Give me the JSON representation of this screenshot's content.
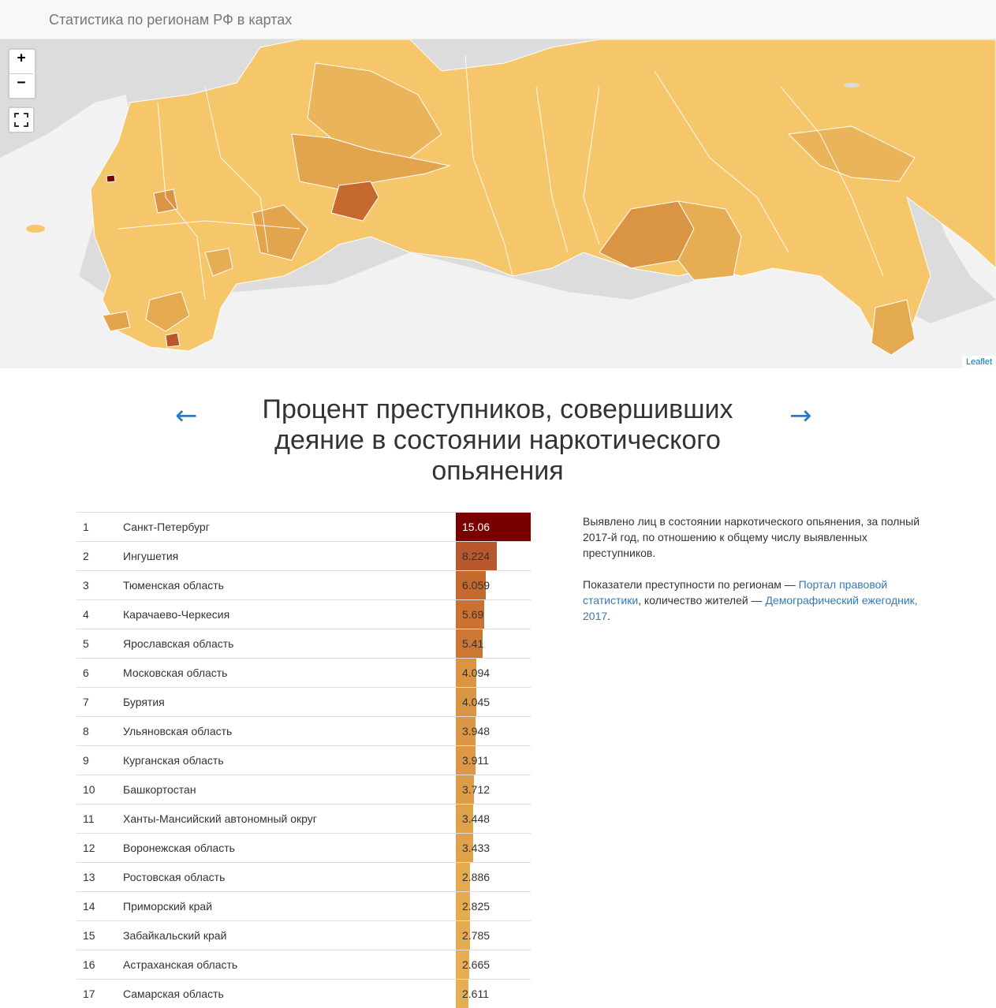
{
  "navbar": {
    "brand": "Статистика по регионам РФ в картах"
  },
  "map": {
    "zoom_in": "+",
    "zoom_out": "−",
    "attribution": "Leaflet"
  },
  "nav": {
    "prev": "←",
    "next": "→"
  },
  "title": "Процент преступников, совершивших деяние в состоянии наркотического опьянения",
  "colors": {
    "max": "#7a0000",
    "high": "#b9582c",
    "mid": "#d9843a",
    "low": "#e3a44e",
    "base": "#f5c76a",
    "link": "#337ab7"
  },
  "table": {
    "max_value": 15.06,
    "rows": [
      {
        "rank": "1",
        "name": "Санкт-Петербург",
        "value": "15.06",
        "num": 15.06,
        "color": "#7a0000",
        "light": true
      },
      {
        "rank": "2",
        "name": "Ингушетия",
        "value": "8.224",
        "num": 8.224,
        "color": "#b9582c",
        "light": false
      },
      {
        "rank": "3",
        "name": "Тюменская область",
        "value": "6.059",
        "num": 6.059,
        "color": "#c6692e",
        "light": false
      },
      {
        "rank": "4",
        "name": "Карачаево-Черкесия",
        "value": "5.69",
        "num": 5.69,
        "color": "#cb7233",
        "light": false
      },
      {
        "rank": "5",
        "name": "Ярославская область",
        "value": "5.41",
        "num": 5.41,
        "color": "#cd7735",
        "light": false
      },
      {
        "rank": "6",
        "name": "Московская область",
        "value": "4.094",
        "num": 4.094,
        "color": "#da9443",
        "light": false
      },
      {
        "rank": "7",
        "name": "Бурятия",
        "value": "4.045",
        "num": 4.045,
        "color": "#da9544",
        "light": false
      },
      {
        "rank": "8",
        "name": "Ульяновская область",
        "value": "3.948",
        "num": 3.948,
        "color": "#dc9746",
        "light": false
      },
      {
        "rank": "9",
        "name": "Курганская область",
        "value": "3.911",
        "num": 3.911,
        "color": "#dc9846",
        "light": false
      },
      {
        "rank": "10",
        "name": "Башкортостан",
        "value": "3.712",
        "num": 3.712,
        "color": "#de9c48",
        "light": false
      },
      {
        "rank": "11",
        "name": "Ханты-Мансийский автономный округ",
        "value": "3.448",
        "num": 3.448,
        "color": "#e0a14b",
        "light": false
      },
      {
        "rank": "12",
        "name": "Воронежская область",
        "value": "3.433",
        "num": 3.433,
        "color": "#e0a14b",
        "light": false
      },
      {
        "rank": "13",
        "name": "Ростовская область",
        "value": "2.886",
        "num": 2.886,
        "color": "#e5aa50",
        "light": false
      },
      {
        "rank": "14",
        "name": "Приморский край",
        "value": "2.825",
        "num": 2.825,
        "color": "#e5ab51",
        "light": false
      },
      {
        "rank": "15",
        "name": "Забайкальский край",
        "value": "2.785",
        "num": 2.785,
        "color": "#e5ab51",
        "light": false
      },
      {
        "rank": "16",
        "name": "Астраханская область",
        "value": "2.665",
        "num": 2.665,
        "color": "#e6ad52",
        "light": false
      },
      {
        "rank": "17",
        "name": "Самарская область",
        "value": "2.611",
        "num": 2.611,
        "color": "#e6ae53",
        "light": false
      }
    ]
  },
  "description": {
    "p1": "Выявлено лиц в состоянии наркотического опьянения, за полный 2017-й год, по отношению к общему числу выявленных преступников.",
    "p2_prefix": "Показатели преступности по регионам — ",
    "p2_link1": "Портал правовой статистики",
    "p2_middle": ", количество жителей — ",
    "p2_link2": "Демографический ежегодник, 2017",
    "p2_suffix": "."
  }
}
